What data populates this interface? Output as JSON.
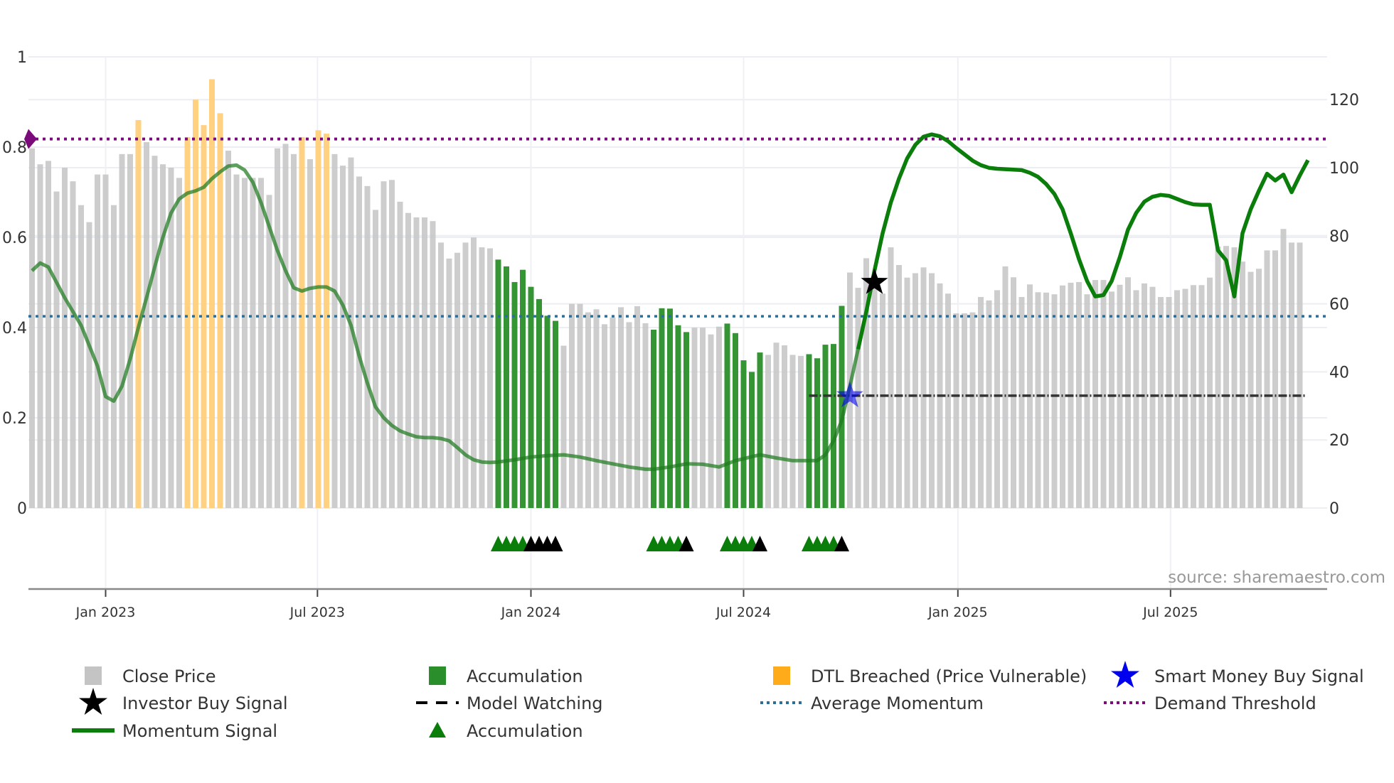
{
  "chart_data": {
    "type": "bar",
    "title": "",
    "xlabel": "",
    "ylabel_left": "",
    "ylabel_right": "",
    "x_unit": "week index",
    "x_range": [
      -0.5,
      156.5
    ],
    "left_axis": {
      "ylim": [
        0,
        1
      ],
      "ticks": [
        {
          "v": 0,
          "label": "0"
        },
        {
          "v": 0.2,
          "label": "0.2"
        },
        {
          "v": 0.4,
          "label": "0.4"
        },
        {
          "v": 0.6,
          "label": "0.6"
        },
        {
          "v": 0.8,
          "label": "0.8"
        },
        {
          "v": 1,
          "label": "1"
        }
      ]
    },
    "right_axis": {
      "ylim": [
        0,
        120
      ],
      "ticks": [
        {
          "v": 0,
          "label": "0"
        },
        {
          "v": 20,
          "label": "20"
        },
        {
          "v": 40,
          "label": "40"
        },
        {
          "v": 60,
          "label": "60"
        },
        {
          "v": 80,
          "label": "80"
        },
        {
          "v": 100,
          "label": "100"
        },
        {
          "v": 120,
          "label": "120"
        }
      ]
    },
    "x_ticks": [
      {
        "v": 9,
        "label": "Jan 2023"
      },
      {
        "v": 34.9,
        "label": "Jul 2023"
      },
      {
        "v": 61,
        "label": "Jan 2024"
      },
      {
        "v": 87,
        "label": "Jul 2024"
      },
      {
        "v": 113.2,
        "label": "Jan 2025"
      },
      {
        "v": 139.2,
        "label": "Jul 2025"
      }
    ],
    "grid": true,
    "close_price": [
      105.7,
      101,
      102,
      93,
      100,
      96,
      89,
      84,
      98,
      98,
      89,
      104,
      104,
      114,
      107.5,
      103.5,
      101,
      100,
      97,
      109,
      120,
      112.5,
      126,
      116,
      105,
      98,
      97,
      97,
      97,
      92,
      105.7,
      107,
      104,
      109,
      102.5,
      111,
      110,
      104,
      100.6,
      103,
      97.4,
      94.6,
      87.6,
      96,
      96.4,
      90,
      86.7,
      85.4,
      85.4,
      84.3,
      78,
      73.3,
      75,
      78,
      79.5,
      76.6,
      76.3,
      73,
      71,
      66.4,
      70,
      65,
      61.4,
      56.5,
      55,
      47.7,
      60,
      60,
      57.5,
      58.4,
      54,
      56,
      59,
      54.6,
      59.3,
      54.3,
      52.4,
      58.7,
      58.6,
      53.7,
      51.7,
      53,
      53,
      51,
      53.3,
      54.2,
      51.4,
      43.4,
      40,
      45.7,
      45,
      48.6,
      47.8,
      45,
      44.7,
      45.2,
      44,
      48,
      48.2,
      59.4,
      69.2,
      64.7,
      73.4,
      65.5,
      63,
      76.6,
      71.4,
      67.7,
      69,
      70.7,
      69,
      66,
      63,
      57.2,
      57.2,
      57.5,
      62,
      61,
      64,
      71,
      67.8,
      62,
      65.7,
      63.4,
      63.3,
      62.8,
      65.4,
      66.2,
      66.4,
      62.8,
      67,
      67,
      63.6,
      65.6,
      67.8,
      64,
      66,
      65,
      62,
      62,
      64,
      64.4,
      65.5,
      65.5,
      67.7,
      76.8,
      77,
      76.6,
      72.4,
      69.4,
      70.3,
      75.7,
      75.7,
      82,
      78,
      78
    ],
    "accumulation_bar_weeks": [
      57,
      58,
      59,
      60,
      61,
      62,
      63,
      64,
      76,
      77,
      78,
      79,
      80,
      85,
      86,
      87,
      88,
      89,
      95,
      96,
      97,
      98,
      99
    ],
    "dtl_breached_weeks": [
      13,
      19,
      20,
      21,
      22,
      23,
      33,
      35,
      36
    ],
    "momentum_signal": [
      [
        0,
        0.526
      ],
      [
        1,
        0.543
      ],
      [
        2,
        0.534
      ],
      [
        4,
        0.466
      ],
      [
        6,
        0.405
      ],
      [
        8,
        0.315
      ],
      [
        9,
        0.247
      ],
      [
        10,
        0.237
      ],
      [
        11,
        0.27
      ],
      [
        12,
        0.33
      ],
      [
        13,
        0.4
      ],
      [
        14,
        0.466
      ],
      [
        15,
        0.534
      ],
      [
        16,
        0.6
      ],
      [
        17,
        0.654
      ],
      [
        18,
        0.685
      ],
      [
        19,
        0.698
      ],
      [
        20,
        0.703
      ],
      [
        21,
        0.711
      ],
      [
        22,
        0.73
      ],
      [
        23,
        0.745
      ],
      [
        24,
        0.758
      ],
      [
        25,
        0.76
      ],
      [
        26,
        0.749
      ],
      [
        27,
        0.722
      ],
      [
        28,
        0.677
      ],
      [
        29,
        0.624
      ],
      [
        30,
        0.571
      ],
      [
        31,
        0.526
      ],
      [
        32,
        0.488
      ],
      [
        33,
        0.481
      ],
      [
        34,
        0.487
      ],
      [
        35,
        0.49
      ],
      [
        36,
        0.49
      ],
      [
        37,
        0.481
      ],
      [
        38,
        0.45
      ],
      [
        39,
        0.405
      ],
      [
        40,
        0.337
      ],
      [
        41,
        0.277
      ],
      [
        42,
        0.224
      ],
      [
        43,
        0.2
      ],
      [
        44,
        0.183
      ],
      [
        45,
        0.171
      ],
      [
        46,
        0.164
      ],
      [
        47,
        0.158
      ],
      [
        48,
        0.156
      ],
      [
        49,
        0.156
      ],
      [
        50,
        0.154
      ],
      [
        51,
        0.149
      ],
      [
        52,
        0.134
      ],
      [
        53,
        0.118
      ],
      [
        54,
        0.107
      ],
      [
        55,
        0.102
      ],
      [
        56,
        0.101
      ],
      [
        57,
        0.102
      ],
      [
        59,
        0.107
      ],
      [
        61,
        0.113
      ],
      [
        63,
        0.116
      ],
      [
        65,
        0.118
      ],
      [
        67,
        0.113
      ],
      [
        69,
        0.105
      ],
      [
        71,
        0.098
      ],
      [
        73,
        0.091
      ],
      [
        75,
        0.086
      ],
      [
        76,
        0.086
      ],
      [
        78,
        0.091
      ],
      [
        80,
        0.098
      ],
      [
        82,
        0.097
      ],
      [
        84,
        0.091
      ],
      [
        86,
        0.105
      ],
      [
        89,
        0.118
      ],
      [
        91,
        0.111
      ],
      [
        93,
        0.105
      ],
      [
        96,
        0.105
      ],
      [
        97,
        0.118
      ],
      [
        98,
        0.149
      ],
      [
        99,
        0.194
      ],
      [
        100,
        0.27
      ],
      [
        101,
        0.352
      ],
      [
        102,
        0.435
      ],
      [
        103,
        0.526
      ],
      [
        104,
        0.609
      ],
      [
        105,
        0.677
      ],
      [
        106,
        0.73
      ],
      [
        107,
        0.775
      ],
      [
        108,
        0.805
      ],
      [
        109,
        0.823
      ],
      [
        110,
        0.828
      ],
      [
        111,
        0.824
      ],
      [
        112,
        0.813
      ],
      [
        113,
        0.798
      ],
      [
        114,
        0.784
      ],
      [
        115,
        0.77
      ],
      [
        116,
        0.76
      ],
      [
        117,
        0.754
      ],
      [
        118,
        0.752
      ],
      [
        120,
        0.75
      ],
      [
        121,
        0.749
      ],
      [
        122,
        0.743
      ],
      [
        123,
        0.734
      ],
      [
        124,
        0.718
      ],
      [
        125,
        0.696
      ],
      [
        126,
        0.662
      ],
      [
        127,
        0.609
      ],
      [
        128,
        0.552
      ],
      [
        129,
        0.503
      ],
      [
        130,
        0.469
      ],
      [
        131,
        0.472
      ],
      [
        132,
        0.503
      ],
      [
        133,
        0.556
      ],
      [
        134,
        0.617
      ],
      [
        135,
        0.654
      ],
      [
        136,
        0.679
      ],
      [
        137,
        0.69
      ],
      [
        138,
        0.694
      ],
      [
        139,
        0.692
      ],
      [
        140,
        0.685
      ],
      [
        141,
        0.678
      ],
      [
        142,
        0.673
      ],
      [
        143,
        0.672
      ],
      [
        144,
        0.672
      ],
      [
        145,
        0.571
      ],
      [
        146,
        0.549
      ],
      [
        147,
        0.469
      ],
      [
        148,
        0.609
      ],
      [
        149,
        0.662
      ],
      [
        150,
        0.703
      ],
      [
        151,
        0.741
      ],
      [
        152,
        0.726
      ],
      [
        153,
        0.739
      ],
      [
        154,
        0.7
      ],
      [
        155,
        0.737
      ],
      [
        156,
        0.771
      ]
    ],
    "average_momentum": 0.425,
    "demand_threshold": 0.818,
    "model_watching": {
      "from_week": 95,
      "to_week": 155,
      "price": 33
    },
    "investor_buy_signal": {
      "week": 103,
      "momentum": 0.5
    },
    "smart_money_buy_signal": {
      "week": 100,
      "price": 33
    },
    "accumulation_markers": {
      "green_weeks": [
        57,
        58,
        59,
        60,
        76,
        77,
        78,
        79,
        85,
        86,
        87,
        88,
        95,
        96,
        97,
        98
      ],
      "black_weeks": [
        61,
        62,
        63,
        64,
        80,
        89,
        99
      ]
    },
    "source": "source: sharemaestro.com",
    "legend": [
      {
        "label": "Close Price",
        "symbol": "gray-square"
      },
      {
        "label": "Accumulation",
        "symbol": "green-square"
      },
      {
        "label": "DTL Breached (Price Vulnerable)",
        "symbol": "orange-square"
      },
      {
        "label": "Smart Money Buy Signal",
        "symbol": "blue-star"
      },
      {
        "label": "Investor Buy Signal",
        "symbol": "black-star"
      },
      {
        "label": "Model Watching",
        "symbol": "black-dash"
      },
      {
        "label": "Average Momentum",
        "symbol": "blue-dots"
      },
      {
        "label": "Demand Threshold",
        "symbol": "purple-dots"
      },
      {
        "label": "Momentum Signal",
        "symbol": "green-line"
      },
      {
        "label": "Accumulation",
        "symbol": "green-triangle"
      }
    ],
    "legend_placement": "bottom",
    "colors": {
      "price": "#c4c4c4",
      "accum": "#2a8f2a",
      "dtl": "#ffcf7a",
      "momentum": "#0a7d0a",
      "avg": "#2b6f99",
      "demand": "#7b0a7b",
      "watch": "#333333",
      "smart": "#0000ee"
    }
  }
}
